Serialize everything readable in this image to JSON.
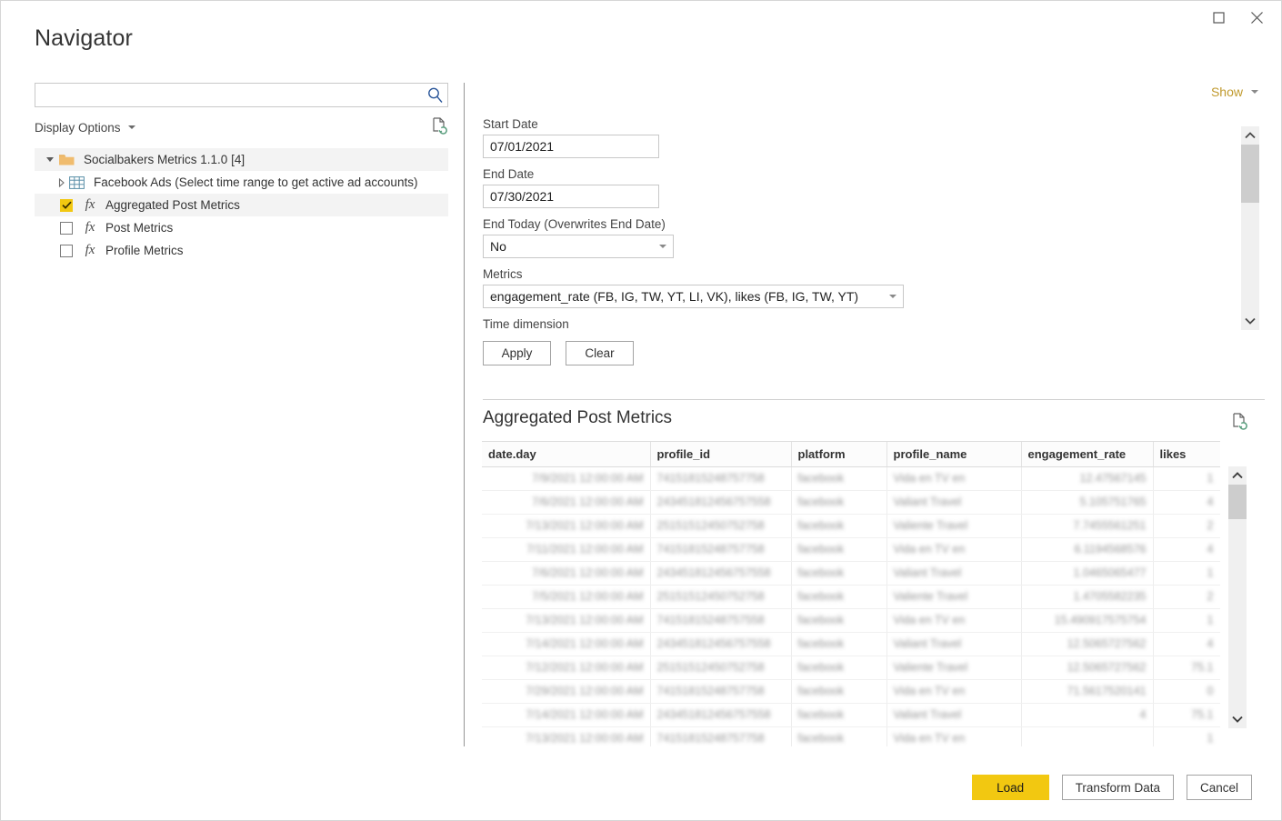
{
  "window": {
    "title": "Navigator",
    "maximize_icon": "maximize-icon",
    "close_icon": "close-icon"
  },
  "search": {
    "value": "",
    "placeholder": "",
    "icon": "search-icon"
  },
  "display_options": {
    "label": "Display Options",
    "caret_icon": "chevron-down-icon",
    "refresh_icon": "refresh-document-icon"
  },
  "tree": {
    "items": [
      {
        "label": "Socialbakers Metrics 1.1.0 [4]",
        "icon": "folder-icon",
        "expander": "triangle-open-icon",
        "level": 0,
        "selected": true,
        "checkbox": null
      },
      {
        "label": "Facebook Ads (Select time range to get active ad accounts)",
        "icon": "table-grid-icon",
        "expander": "triangle-closed-icon",
        "level": 1,
        "selected": false,
        "checkbox": null
      },
      {
        "label": "Aggregated Post Metrics",
        "icon": "function-fx-icon",
        "expander": null,
        "level": 2,
        "selected": true,
        "checkbox": "checked"
      },
      {
        "label": "Post Metrics",
        "icon": "function-fx-icon",
        "expander": null,
        "level": 2,
        "selected": false,
        "checkbox": "unchecked"
      },
      {
        "label": "Profile Metrics",
        "icon": "function-fx-icon",
        "expander": null,
        "level": 2,
        "selected": false,
        "checkbox": "unchecked"
      }
    ]
  },
  "show": {
    "label": "Show",
    "caret_icon": "chevron-down-icon"
  },
  "parameters": {
    "start_date": {
      "label": "Start Date",
      "value": "07/01/2021"
    },
    "end_date": {
      "label": "End Date",
      "value": "07/30/2021"
    },
    "end_today": {
      "label": "End Today (Overwrites End Date)",
      "value": "No"
    },
    "metrics": {
      "label": "Metrics",
      "value": "engagement_rate (FB, IG, TW, YT, LI, VK), likes (FB, IG, TW, YT)"
    },
    "time_dimension": {
      "label": "Time dimension"
    },
    "apply_label": "Apply",
    "clear_label": "Clear"
  },
  "preview": {
    "title": "Aggregated Post Metrics",
    "refresh_icon": "refresh-document-icon",
    "columns": [
      "date.day",
      "profile_id",
      "platform",
      "profile_name",
      "engagement_rate",
      "likes"
    ],
    "rows": [
      [
        "7/9/2021 12:00:00 AM",
        "74151815248757758",
        "facebook",
        "Vida en TV en",
        "12.47567145",
        "1"
      ],
      [
        "7/6/2021 12:00:00 AM",
        "243451812456757558",
        "facebook",
        "Valiant Travel",
        "5.105751765",
        "4"
      ],
      [
        "7/13/2021 12:00:00 AM",
        "25151512450752758",
        "facebook",
        "Valiente Travel",
        "7.7455561251",
        "2"
      ],
      [
        "7/11/2021 12:00:00 AM",
        "74151815248757758",
        "facebook",
        "Vida en TV en",
        "6.1194568576",
        "4"
      ],
      [
        "7/6/2021 12:00:00 AM",
        "243451812456757558",
        "facebook",
        "Valiant Travel",
        "1.0465065477",
        "1"
      ],
      [
        "7/5/2021 12:00:00 AM",
        "25151512450752758",
        "facebook",
        "Valiente Travel",
        "1.4705582235",
        "2"
      ],
      [
        "7/13/2021 12:00:00 AM",
        "74151815248757558",
        "facebook",
        "Vida en TV en",
        "15.490917575754",
        "1"
      ],
      [
        "7/14/2021 12:00:00 AM",
        "243451812456757558",
        "facebook",
        "Valiant Travel",
        "12.5065727562",
        "4"
      ],
      [
        "7/12/2021 12:00:00 AM",
        "25151512450752758",
        "facebook",
        "Valiente Travel",
        "12.5065727562",
        "75.1"
      ],
      [
        "7/29/2021 12:00:00 AM",
        "74151815248757758",
        "facebook",
        "Vida en TV en",
        "71.5617520141",
        "0"
      ],
      [
        "7/14/2021 12:00:00 AM",
        "243451812456757558",
        "facebook",
        "Valiant Travel",
        "4",
        "75.1"
      ],
      [
        "7/13/2021 12:00:00 AM",
        "74151815248757758",
        "facebook",
        "Vida en TV en",
        "",
        "1"
      ]
    ]
  },
  "footer": {
    "load_label": "Load",
    "transform_label": "Transform Data",
    "cancel_label": "Cancel"
  },
  "colors": {
    "accent_yellow": "#f2c811",
    "show_gold": "#c09a2e",
    "search_blue": "#2b579a",
    "folder_tan": "#f0bc6e",
    "refresh_green": "#5a9e7e"
  }
}
